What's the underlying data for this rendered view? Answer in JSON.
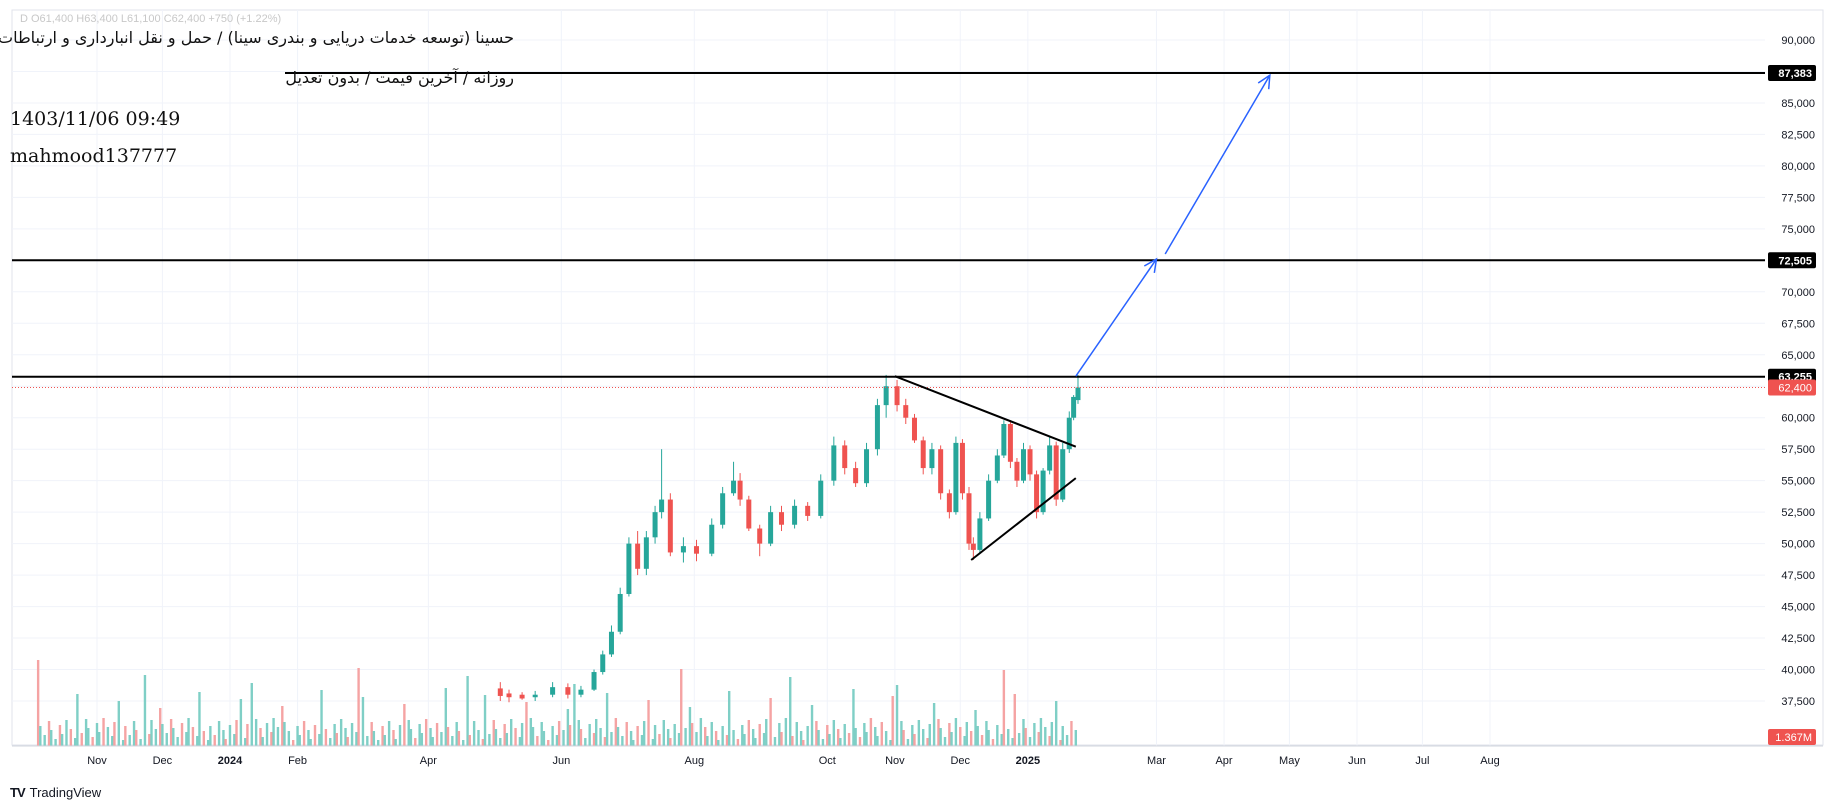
{
  "header": {
    "ohlc": "D  O61,400  H63,400  L61,100  C62,400  +750 (+1.22%)",
    "title_fa": "حسینا (توسعه خدمات دریایی و بندری سینا) / حمل و نقل انبارداری و ارتباطات",
    "subtitle_fa": "روزانه / آخرین قیمت / بدون تعدیل",
    "timestamp": "1403/11/06 09:49",
    "author": "mahmood137777"
  },
  "brand": {
    "name": "TradingView",
    "logo": "TV"
  },
  "colors": {
    "up": "#26a69a",
    "down": "#ef5350",
    "vol_up": "#7fcfc6",
    "vol_down": "#f5a3a3",
    "level": "#000000",
    "arrow": "#2962ff",
    "grid": "#f0f3fa",
    "text": "#131722"
  },
  "chart_data": {
    "type": "candlestick",
    "y_axis": {
      "ticks": [
        "37,500",
        "40,000",
        "42,500",
        "45,000",
        "47,500",
        "50,000",
        "52,500",
        "55,000",
        "57,500",
        "60,000",
        "62,500",
        "65,000",
        "67,500",
        "70,000",
        "72,500",
        "75,000",
        "77,500",
        "80,000",
        "82,500",
        "85,000",
        "87,500",
        "90,000"
      ],
      "range": [
        37000,
        92000
      ]
    },
    "x_axis": {
      "ticks": [
        {
          "label": "Nov",
          "date": "2023-11-01"
        },
        {
          "label": "Dec",
          "date": "2023-12-01"
        },
        {
          "label": "2024",
          "date": "2024-01-01"
        },
        {
          "label": "Feb",
          "date": "2024-02-01"
        },
        {
          "label": "Apr",
          "date": "2024-04-01"
        },
        {
          "label": "Jun",
          "date": "2024-06-01"
        },
        {
          "label": "Aug",
          "date": "2024-08-01"
        },
        {
          "label": "Oct",
          "date": "2024-10-01"
        },
        {
          "label": "Nov",
          "date": "2024-11-01"
        },
        {
          "label": "Dec",
          "date": "2024-12-01"
        },
        {
          "label": "2025",
          "date": "2025-01-01"
        },
        {
          "label": "Mar",
          "date": "2025-03-01"
        },
        {
          "label": "Apr",
          "date": "2025-04-01"
        },
        {
          "label": "May",
          "date": "2025-05-01"
        },
        {
          "label": "Jun",
          "date": "2025-06-01"
        },
        {
          "label": "Jul",
          "date": "2025-07-01"
        },
        {
          "label": "Aug",
          "date": "2025-08-01"
        }
      ]
    },
    "last_price": {
      "value": 62400,
      "label": "62,400"
    },
    "last_volume": {
      "label": "1.367M"
    },
    "levels": [
      {
        "value": 63255,
        "label": "63,255"
      },
      {
        "value": 72505,
        "label": "72,505"
      },
      {
        "value": 87383,
        "label": "87,383"
      }
    ],
    "triangle": {
      "upper": [
        {
          "date": "2024-11-01",
          "price": 63300
        },
        {
          "date": "2025-01-23",
          "price": 57700
        }
      ],
      "lower": [
        {
          "date": "2024-12-06",
          "price": 48700
        },
        {
          "date": "2025-01-23",
          "price": 55200
        }
      ]
    },
    "arrow": [
      {
        "date": "2025-01-23",
        "price": 63300
      },
      {
        "date": "2025-03-01",
        "price": 72600
      },
      {
        "date": "2025-03-05",
        "price": 73000
      },
      {
        "date": "2025-04-22",
        "price": 87200
      }
    ],
    "candles": [
      {
        "date": "2024-05-04",
        "o": 38500,
        "h": 39000,
        "l": 37500,
        "c": 37900
      },
      {
        "date": "2024-05-08",
        "o": 38100,
        "h": 38400,
        "l": 37400,
        "c": 37800
      },
      {
        "date": "2024-05-14",
        "o": 38000,
        "h": 38200,
        "l": 37600,
        "c": 37700
      },
      {
        "date": "2024-05-20",
        "o": 37800,
        "h": 38300,
        "l": 37500,
        "c": 38000
      },
      {
        "date": "2024-05-28",
        "o": 38000,
        "h": 39000,
        "l": 37800,
        "c": 38600
      },
      {
        "date": "2024-06-04",
        "o": 38600,
        "h": 38900,
        "l": 37700,
        "c": 38000
      },
      {
        "date": "2024-06-10",
        "o": 38000,
        "h": 38700,
        "l": 37800,
        "c": 38400
      },
      {
        "date": "2024-06-16",
        "o": 38400,
        "h": 40000,
        "l": 38300,
        "c": 39800
      },
      {
        "date": "2024-06-20",
        "o": 39800,
        "h": 41500,
        "l": 39600,
        "c": 41200
      },
      {
        "date": "2024-06-24",
        "o": 41200,
        "h": 43500,
        "l": 41000,
        "c": 43000
      },
      {
        "date": "2024-06-28",
        "o": 43000,
        "h": 46500,
        "l": 42800,
        "c": 46000
      },
      {
        "date": "2024-07-02",
        "o": 46000,
        "h": 50500,
        "l": 45800,
        "c": 50000
      },
      {
        "date": "2024-07-06",
        "o": 50000,
        "h": 51000,
        "l": 47500,
        "c": 48000
      },
      {
        "date": "2024-07-10",
        "o": 48000,
        "h": 51000,
        "l": 47500,
        "c": 50500
      },
      {
        "date": "2024-07-14",
        "o": 50500,
        "h": 53000,
        "l": 50000,
        "c": 52500
      },
      {
        "date": "2024-07-17",
        "o": 52500,
        "h": 57500,
        "l": 52000,
        "c": 53500
      },
      {
        "date": "2024-07-21",
        "o": 53500,
        "h": 54000,
        "l": 49000,
        "c": 49300
      },
      {
        "date": "2024-07-27",
        "o": 49300,
        "h": 50500,
        "l": 48500,
        "c": 49800
      },
      {
        "date": "2024-08-02",
        "o": 49800,
        "h": 50300,
        "l": 48600,
        "c": 49200
      },
      {
        "date": "2024-08-09",
        "o": 49200,
        "h": 52000,
        "l": 49000,
        "c": 51500
      },
      {
        "date": "2024-08-14",
        "o": 51500,
        "h": 54500,
        "l": 51200,
        "c": 54000
      },
      {
        "date": "2024-08-19",
        "o": 54000,
        "h": 56500,
        "l": 53800,
        "c": 55000
      },
      {
        "date": "2024-08-22",
        "o": 55000,
        "h": 55600,
        "l": 53000,
        "c": 53500
      },
      {
        "date": "2024-08-26",
        "o": 53500,
        "h": 53800,
        "l": 51000,
        "c": 51200
      },
      {
        "date": "2024-08-31",
        "o": 51200,
        "h": 51500,
        "l": 49000,
        "c": 50000
      },
      {
        "date": "2024-09-05",
        "o": 50000,
        "h": 53000,
        "l": 49800,
        "c": 52500
      },
      {
        "date": "2024-09-10",
        "o": 52500,
        "h": 53000,
        "l": 51000,
        "c": 51500
      },
      {
        "date": "2024-09-16",
        "o": 51500,
        "h": 53500,
        "l": 51200,
        "c": 53000
      },
      {
        "date": "2024-09-22",
        "o": 53000,
        "h": 53300,
        "l": 51800,
        "c": 52200
      },
      {
        "date": "2024-09-28",
        "o": 52200,
        "h": 55500,
        "l": 52000,
        "c": 55000
      },
      {
        "date": "2024-10-04",
        "o": 55000,
        "h": 58500,
        "l": 54600,
        "c": 57800
      },
      {
        "date": "2024-10-09",
        "o": 57800,
        "h": 58200,
        "l": 55500,
        "c": 56000
      },
      {
        "date": "2024-10-14",
        "o": 56000,
        "h": 56500,
        "l": 54500,
        "c": 54800
      },
      {
        "date": "2024-10-19",
        "o": 54800,
        "h": 58000,
        "l": 54500,
        "c": 57500
      },
      {
        "date": "2024-10-24",
        "o": 57500,
        "h": 61500,
        "l": 57000,
        "c": 61000
      },
      {
        "date": "2024-10-28",
        "o": 61000,
        "h": 63400,
        "l": 60000,
        "c": 62500
      },
      {
        "date": "2024-11-02",
        "o": 62500,
        "h": 63000,
        "l": 60500,
        "c": 61000
      },
      {
        "date": "2024-11-06",
        "o": 61000,
        "h": 61500,
        "l": 59500,
        "c": 60000
      },
      {
        "date": "2024-11-10",
        "o": 60000,
        "h": 60300,
        "l": 58000,
        "c": 58200
      },
      {
        "date": "2024-11-14",
        "o": 58200,
        "h": 58500,
        "l": 55500,
        "c": 56000
      },
      {
        "date": "2024-11-18",
        "o": 56000,
        "h": 58000,
        "l": 55500,
        "c": 57500
      },
      {
        "date": "2024-11-22",
        "o": 57500,
        "h": 57800,
        "l": 53500,
        "c": 54000
      },
      {
        "date": "2024-11-26",
        "o": 54000,
        "h": 54300,
        "l": 52000,
        "c": 52500
      },
      {
        "date": "2024-11-29",
        "o": 52500,
        "h": 58500,
        "l": 52300,
        "c": 58000
      },
      {
        "date": "2024-12-02",
        "o": 58000,
        "h": 58300,
        "l": 53500,
        "c": 54000
      },
      {
        "date": "2024-12-05",
        "o": 54000,
        "h": 54500,
        "l": 49500,
        "c": 50000
      },
      {
        "date": "2024-12-07",
        "o": 50000,
        "h": 50500,
        "l": 48700,
        "c": 49500
      },
      {
        "date": "2024-12-10",
        "o": 49500,
        "h": 52500,
        "l": 49200,
        "c": 52000
      },
      {
        "date": "2024-12-14",
        "o": 52000,
        "h": 55500,
        "l": 51800,
        "c": 55000
      },
      {
        "date": "2024-12-18",
        "o": 55000,
        "h": 57500,
        "l": 54800,
        "c": 57000
      },
      {
        "date": "2024-12-21",
        "o": 57000,
        "h": 59800,
        "l": 56800,
        "c": 59500
      },
      {
        "date": "2024-12-24",
        "o": 59500,
        "h": 59800,
        "l": 56000,
        "c": 56500
      },
      {
        "date": "2024-12-27",
        "o": 56500,
        "h": 56800,
        "l": 54500,
        "c": 55000
      },
      {
        "date": "2024-12-30",
        "o": 55000,
        "h": 58000,
        "l": 54800,
        "c": 57500
      },
      {
        "date": "2025-01-02",
        "o": 57500,
        "h": 57800,
        "l": 55000,
        "c": 55500
      },
      {
        "date": "2025-01-05",
        "o": 55500,
        "h": 55800,
        "l": 52000,
        "c": 52500
      },
      {
        "date": "2025-01-08",
        "o": 52500,
        "h": 56000,
        "l": 52300,
        "c": 55800
      },
      {
        "date": "2025-01-11",
        "o": 55800,
        "h": 58500,
        "l": 55500,
        "c": 57800
      },
      {
        "date": "2025-01-14",
        "o": 57800,
        "h": 58100,
        "l": 53000,
        "c": 53500
      },
      {
        "date": "2025-01-17",
        "o": 53500,
        "h": 58000,
        "l": 53300,
        "c": 57500
      },
      {
        "date": "2025-01-20",
        "o": 57500,
        "h": 60500,
        "l": 57200,
        "c": 60000
      },
      {
        "date": "2025-01-22",
        "o": 60000,
        "h": 61800,
        "l": 59800,
        "c": 61650
      },
      {
        "date": "2025-01-24",
        "o": 61400,
        "h": 63400,
        "l": 61100,
        "c": 62400
      }
    ]
  }
}
